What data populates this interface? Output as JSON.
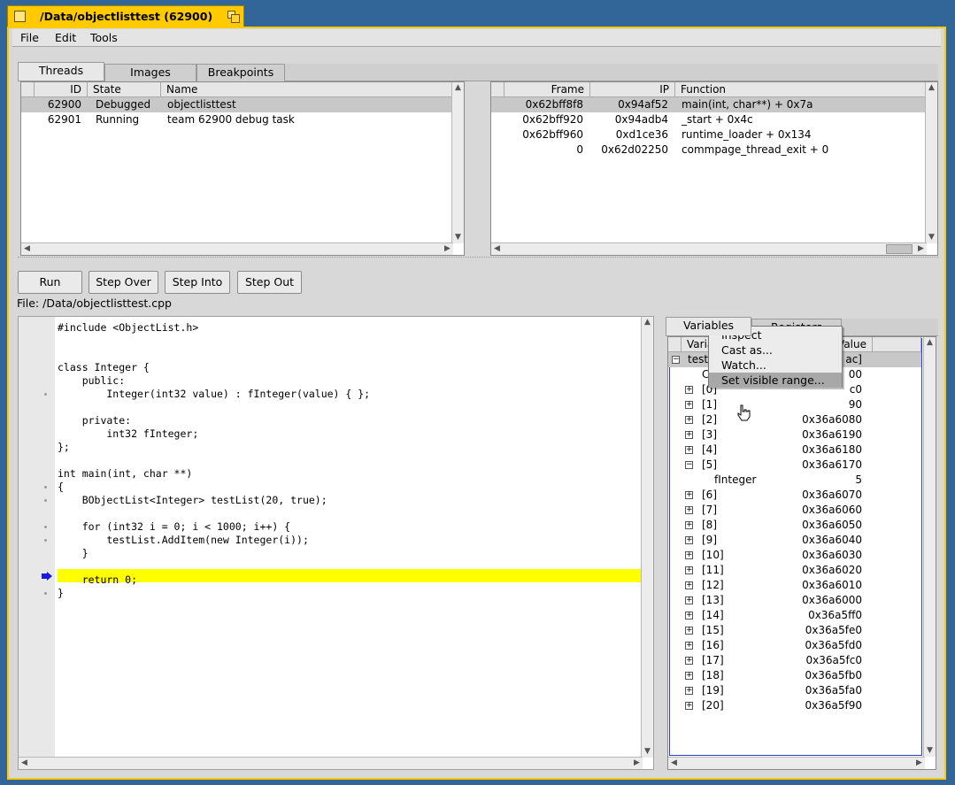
{
  "window": {
    "title": "/Data/objectlisttest (62900)"
  },
  "menu": [
    "File",
    "Edit",
    "Tools"
  ],
  "top_tabs": [
    "Threads",
    "Images",
    "Breakpoints"
  ],
  "threads": {
    "headers": [
      "ID",
      "State",
      "Name"
    ],
    "rows": [
      {
        "id": "62900",
        "state": "Debugged",
        "name": "objectlisttest"
      },
      {
        "id": "62901",
        "state": "Running",
        "name": "team 62900 debug task"
      }
    ]
  },
  "stack": {
    "headers": [
      "Frame",
      "IP",
      "Function"
    ],
    "rows": [
      {
        "frame": "0x62bff8f8",
        "ip": "0x94af52",
        "function": "main(int, char**) + 0x7a"
      },
      {
        "frame": "0x62bff920",
        "ip": "0x94adb4",
        "function": "_start + 0x4c"
      },
      {
        "frame": "0x62bff960",
        "ip": "0xd1ce36",
        "function": "runtime_loader + 0x134"
      },
      {
        "frame": "0",
        "ip": "0x62d02250",
        "function": "commpage_thread_exit + 0"
      }
    ]
  },
  "buttons": [
    "Run",
    "Step Over",
    "Step Into",
    "Step Out"
  ],
  "file_label": "File: /Data/objectlisttest.cpp",
  "source": [
    "#include <ObjectList.h>",
    "",
    "",
    "class Integer {",
    "    public:",
    "        Integer(int32 value) : fInteger(value) { };",
    "",
    "    private:",
    "        int32 fInteger;",
    "};",
    "",
    "int main(int, char **)",
    "{",
    "    BObjectList<Integer> testList(20, true);",
    "",
    "    for (int32 i = 0; i < 1000; i++) {",
    "        testList.AddItem(new Integer(i));",
    "    }",
    "",
    "    return 0;",
    "}"
  ],
  "var_tabs": [
    "Variables",
    "Registers"
  ],
  "variables": {
    "headers": [
      "Variable",
      "Value"
    ],
    "root_name": "testL",
    "root_value": "ac]",
    "child_name": "Ca",
    "child_value": "00",
    "items": [
      {
        "name": "[0]",
        "value": "c0",
        "expanded": false
      },
      {
        "name": "[1]",
        "value": "90",
        "expanded": false
      },
      {
        "name": "[2]",
        "value": "0x36a6080",
        "expanded": false
      },
      {
        "name": "[3]",
        "value": "0x36a6190",
        "expanded": false
      },
      {
        "name": "[4]",
        "value": "0x36a6180",
        "expanded": false
      },
      {
        "name": "[5]",
        "value": "0x36a6170",
        "expanded": true
      },
      {
        "name": "fInteger",
        "value": "5",
        "expanded": null
      },
      {
        "name": "[6]",
        "value": "0x36a6070",
        "expanded": false
      },
      {
        "name": "[7]",
        "value": "0x36a6060",
        "expanded": false
      },
      {
        "name": "[8]",
        "value": "0x36a6050",
        "expanded": false
      },
      {
        "name": "[9]",
        "value": "0x36a6040",
        "expanded": false
      },
      {
        "name": "[10]",
        "value": "0x36a6030",
        "expanded": false
      },
      {
        "name": "[11]",
        "value": "0x36a6020",
        "expanded": false
      },
      {
        "name": "[12]",
        "value": "0x36a6010",
        "expanded": false
      },
      {
        "name": "[13]",
        "value": "0x36a6000",
        "expanded": false
      },
      {
        "name": "[14]",
        "value": "0x36a5ff0",
        "expanded": false
      },
      {
        "name": "[15]",
        "value": "0x36a5fe0",
        "expanded": false
      },
      {
        "name": "[16]",
        "value": "0x36a5fd0",
        "expanded": false
      },
      {
        "name": "[17]",
        "value": "0x36a5fc0",
        "expanded": false
      },
      {
        "name": "[18]",
        "value": "0x36a5fb0",
        "expanded": false
      },
      {
        "name": "[19]",
        "value": "0x36a5fa0",
        "expanded": false
      },
      {
        "name": "[20]",
        "value": "0x36a5f90",
        "expanded": false
      }
    ]
  },
  "context_menu": [
    "Inspect",
    "Cast as...",
    "Watch...",
    "Set visible range..."
  ],
  "colors": {
    "desktop": "#336698",
    "title_tab": "#ffcb00",
    "current_line": "#ffff00"
  }
}
